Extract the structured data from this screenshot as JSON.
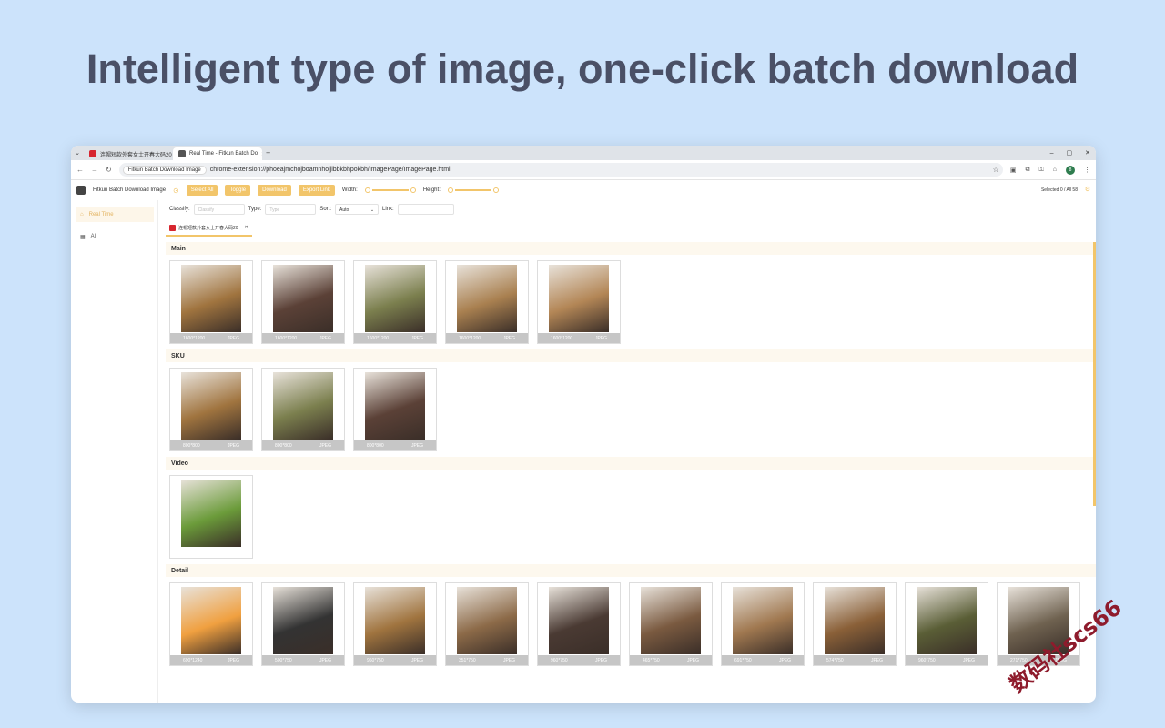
{
  "headline": "Intelligent type of image, one-click batch download",
  "browser": {
    "tabs": [
      {
        "title": "连帽短款外套女士开春大码20",
        "favicon_color": "#d7262f",
        "active": false
      },
      {
        "title": "Real Time - Fitkun Batch Do",
        "favicon_color": "#555555",
        "active": true
      }
    ],
    "address_chip": "Fitkun Batch Download Image",
    "url": "chrome-extension://phoeajmchojboamnhojjibbkbhpokbh/ImagePage/ImagePage.html",
    "avatar_letter": "8"
  },
  "toolbar": {
    "app_name": "Fitkun Batch Download Image",
    "select_all": "Select All",
    "toggle": "Toggle",
    "download": "Download",
    "export_link": "Export Link",
    "width_label": "Width:",
    "height_label": "Height:",
    "selected_count": "Selected 0 / All 58"
  },
  "sidebar": {
    "items": [
      {
        "label": "Real Time",
        "icon": "home-icon",
        "active": true
      },
      {
        "label": "All",
        "icon": "grid-icon",
        "active": false
      }
    ]
  },
  "filters": {
    "classify_label": "Classify:",
    "classify_placeholder": "Classify",
    "type_label": "Type:",
    "type_placeholder": "Type",
    "sort_label": "Sort:",
    "sort_value": "Auto",
    "link_label": "Link:"
  },
  "page_tab": {
    "title": "连帽短款外套女士开春大码20"
  },
  "sections": [
    {
      "title": "Main",
      "items": [
        {
          "size": "1600*1200",
          "format": "JPEG",
          "color": "#a0743f"
        },
        {
          "size": "1600*1200",
          "format": "JPEG",
          "color": "#5b4137"
        },
        {
          "size": "1600*1200",
          "format": "JPEG",
          "color": "#7b7f4e"
        },
        {
          "size": "1600*1200",
          "format": "JPEG",
          "color": "#a98050"
        },
        {
          "size": "1600*1200",
          "format": "JPEG",
          "color": "#b38656"
        }
      ]
    },
    {
      "title": "SKU",
      "items": [
        {
          "size": "800*800",
          "format": "JPEG",
          "color": "#a0743f"
        },
        {
          "size": "800*800",
          "format": "JPEG",
          "color": "#7b7f4e"
        },
        {
          "size": "800*800",
          "format": "JPEG",
          "color": "#5b4137"
        }
      ]
    },
    {
      "title": "Video",
      "items": [
        {
          "size": "",
          "format": "",
          "color": "#6b9b3a"
        }
      ]
    },
    {
      "title": "Detail",
      "items": [
        {
          "size": "690*1240",
          "format": "JPEG",
          "color": "#f0a040"
        },
        {
          "size": "500*750",
          "format": "JPEG",
          "color": "#333333"
        },
        {
          "size": "960*750",
          "format": "JPEG",
          "color": "#a0743f"
        },
        {
          "size": "351*750",
          "format": "JPEG",
          "color": "#8c6a48"
        },
        {
          "size": "960*750",
          "format": "JPEG",
          "color": "#4a3a33"
        },
        {
          "size": "465*750",
          "format": "JPEG",
          "color": "#7a5a40"
        },
        {
          "size": "691*750",
          "format": "JPEG",
          "color": "#a07850"
        },
        {
          "size": "574*750",
          "format": "JPEG",
          "color": "#8a6038"
        },
        {
          "size": "960*750",
          "format": "JPEG",
          "color": "#5a5e36"
        },
        {
          "size": "271*750",
          "format": "JPEG",
          "color": "#6f6250"
        }
      ]
    }
  ],
  "watermark": "数码社scs66"
}
